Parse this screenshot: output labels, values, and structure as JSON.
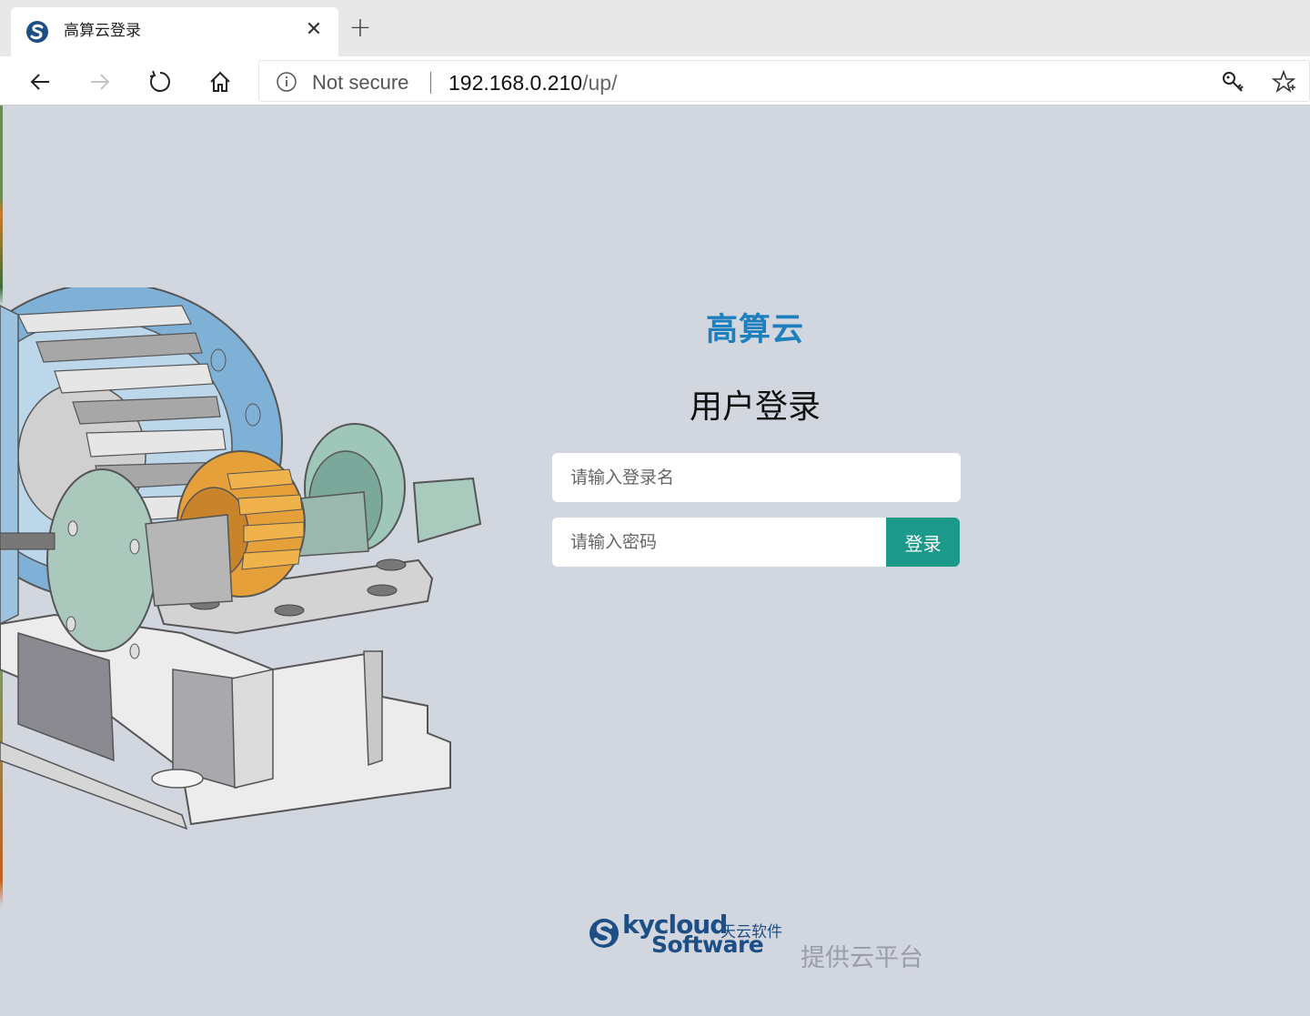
{
  "browser": {
    "tab": {
      "title": "高算云登录",
      "close": "✕"
    },
    "new_tab": "+",
    "security_label": "Not secure",
    "url": {
      "host": "192.168.0.210",
      "path": "/up/"
    }
  },
  "login": {
    "app_title": "高算云",
    "heading": "用户登录",
    "username_placeholder": "请输入登录名",
    "password_placeholder": "请输入密码",
    "submit_label": "登录",
    "button_color": "#1b9a8a",
    "title_color": "#1e7fbf"
  },
  "footer": {
    "logo_text_1": "kycloud",
    "logo_text_cn": "天云软件",
    "logo_text_2": "Software",
    "provider_text": "提供云平台"
  }
}
